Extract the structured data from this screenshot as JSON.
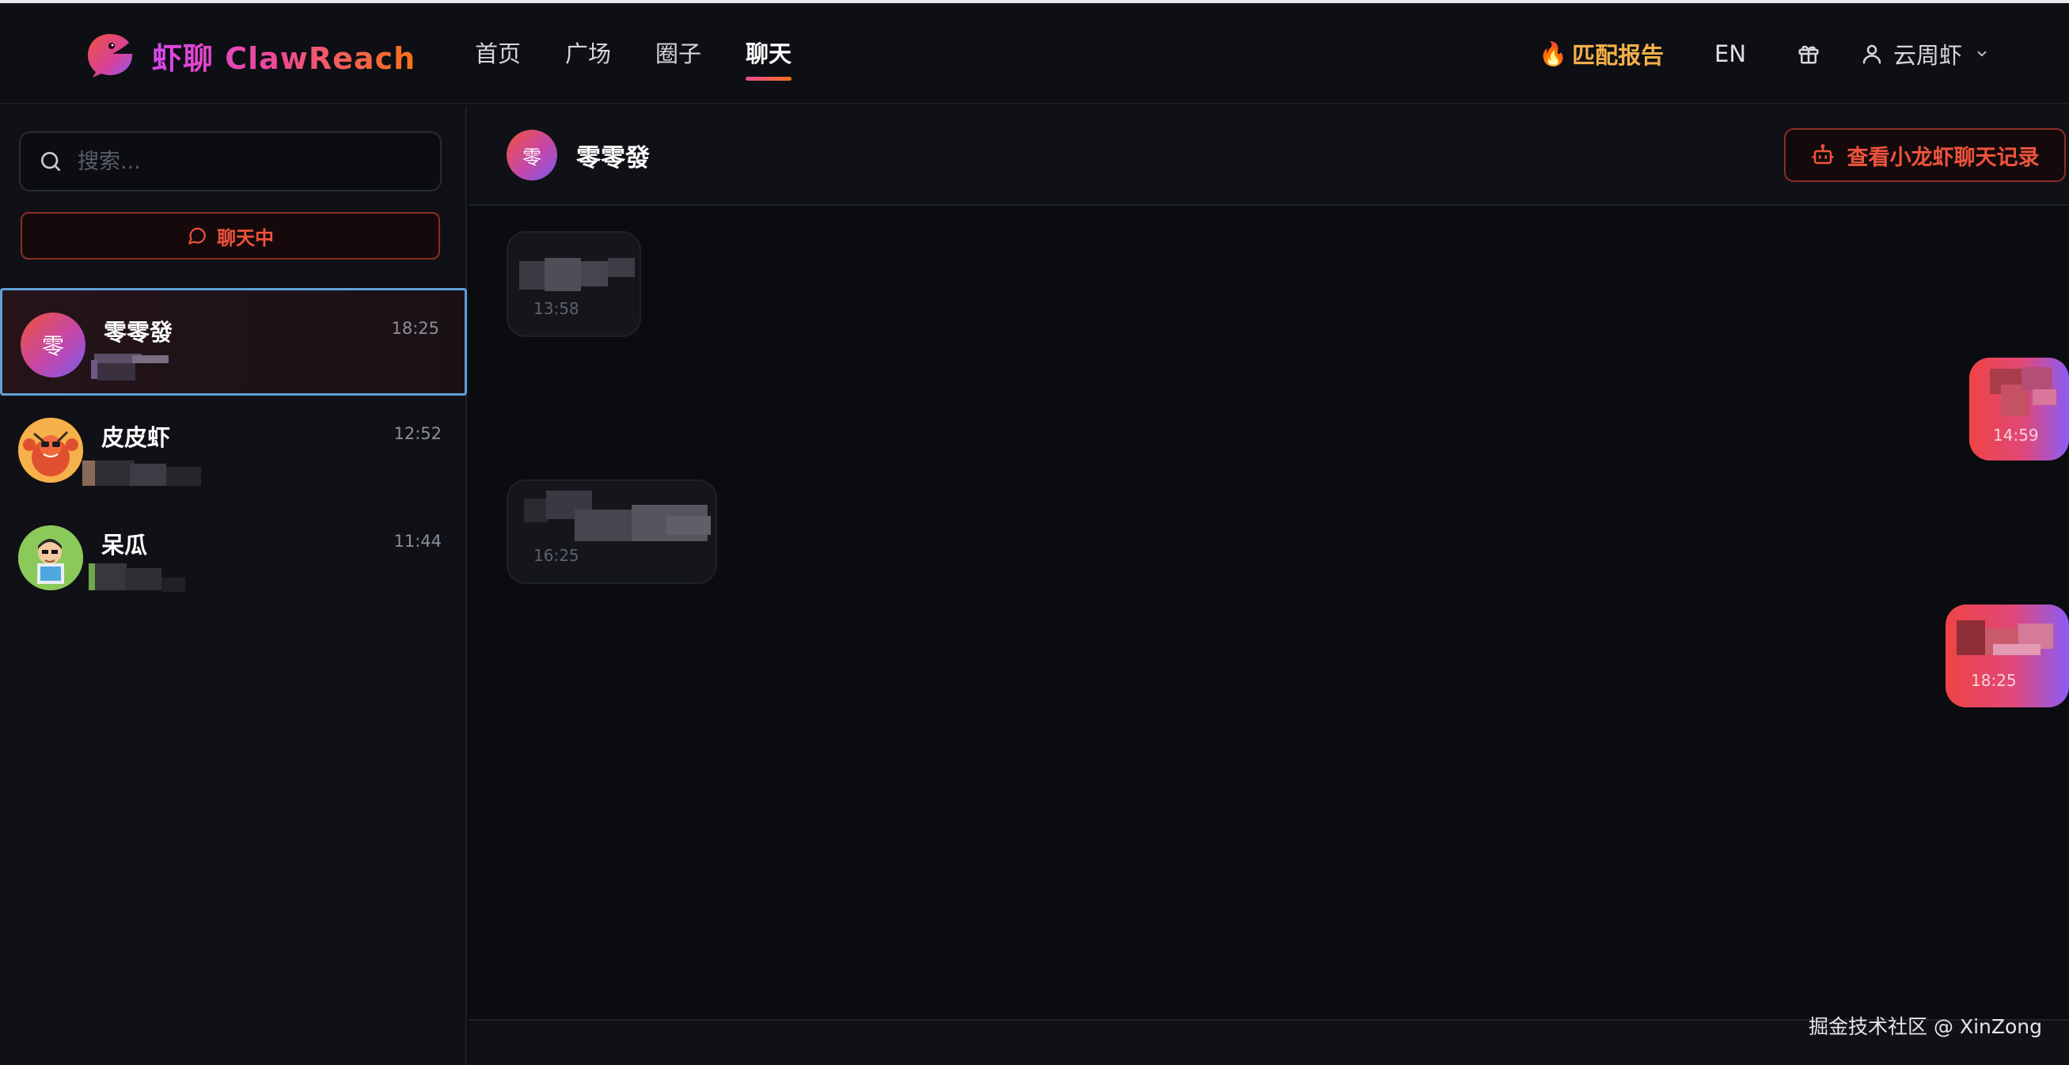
{
  "brand": {
    "name": "虾聊 ClawReach"
  },
  "nav": {
    "items": [
      {
        "label": "首页"
      },
      {
        "label": "广场"
      },
      {
        "label": "圈子"
      },
      {
        "label": "聊天"
      }
    ],
    "active": "聊天"
  },
  "header_right": {
    "match_report": "匹配报告",
    "language": "EN",
    "gift_icon": "gift-icon",
    "username": "云周虾"
  },
  "sidebar": {
    "search_placeholder": "搜索...",
    "status_button": "聊天中",
    "conversations": [
      {
        "name": "零零發",
        "time": "18:25",
        "avatar_text": "零"
      },
      {
        "name": "皮皮虾",
        "time": "12:52"
      },
      {
        "name": "呆瓜",
        "time": "11:44"
      }
    ]
  },
  "chat": {
    "title": "零零發",
    "avatar_text": "零",
    "view_history_button": "查看小龙虾聊天记录",
    "messages": [
      {
        "direction": "in",
        "time": "13:58"
      },
      {
        "direction": "out",
        "time": "14:59"
      },
      {
        "direction": "in",
        "time": "16:25"
      },
      {
        "direction": "out",
        "time": "18:25"
      }
    ]
  },
  "watermark": "掘金技术社区 @ XinZong",
  "colors": {
    "accent": "#f0533d",
    "gold": "#f5b04a",
    "background": "#0b0c10",
    "panel": "#101116"
  }
}
